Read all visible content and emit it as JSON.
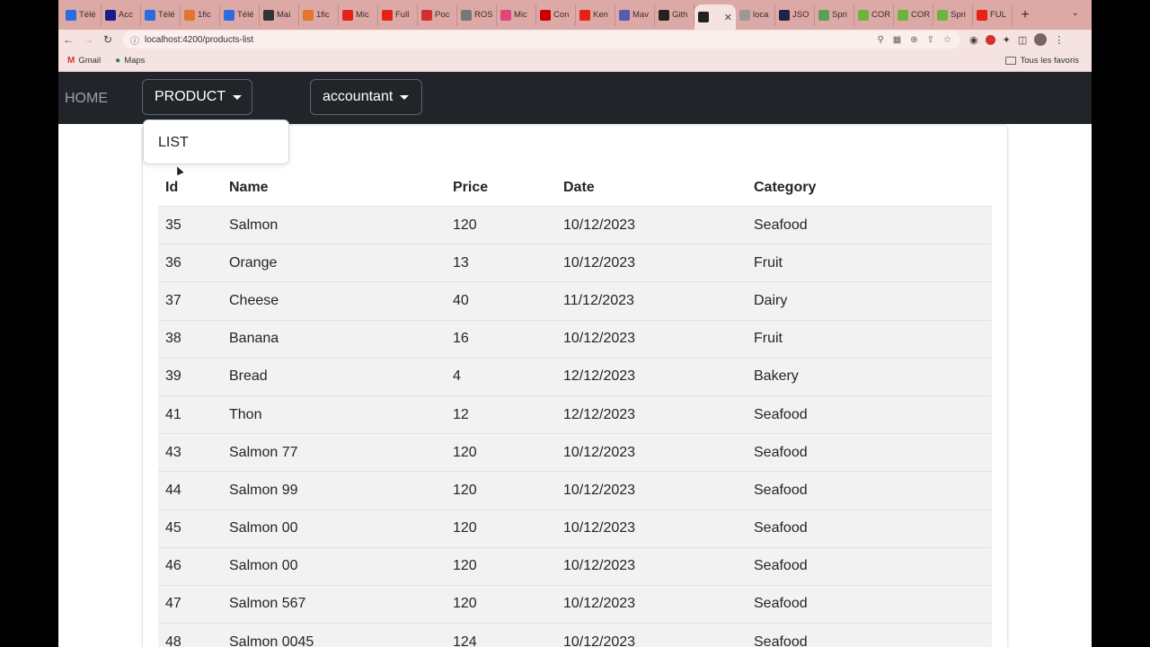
{
  "browser": {
    "tabs": [
      {
        "label": "Télé",
        "icon": "zoom-icon",
        "color": "#2d6cdf"
      },
      {
        "label": "Acc",
        "icon": "v-icon",
        "color": "#1a1a8a"
      },
      {
        "label": "Télé",
        "icon": "zoom-icon",
        "color": "#2d6cdf"
      },
      {
        "label": "1fic",
        "icon": "fire-icon",
        "color": "#e0772a"
      },
      {
        "label": "Télé",
        "icon": "zoom-icon",
        "color": "#2d6cdf"
      },
      {
        "label": "Mai",
        "icon": "mail-icon",
        "color": "#333333"
      },
      {
        "label": "1fic",
        "icon": "fire-icon",
        "color": "#e0772a"
      },
      {
        "label": "Mic",
        "icon": "youtube-icon",
        "color": "#e62117"
      },
      {
        "label": "Full",
        "icon": "youtube-icon",
        "color": "#e62117"
      },
      {
        "label": "Poc",
        "icon": "check-icon",
        "color": "#d0312d"
      },
      {
        "label": "ROS",
        "icon": "search-icon",
        "color": "#777777"
      },
      {
        "label": "Mic",
        "icon": "record-icon",
        "color": "#e0457b"
      },
      {
        "label": "Con",
        "icon": "redhat-icon",
        "color": "#cc0000"
      },
      {
        "label": "Ken",
        "icon": "youtube-icon",
        "color": "#e62117"
      },
      {
        "label": "Mav",
        "icon": "maven-icon",
        "color": "#5a5ab0"
      },
      {
        "label": "Gith",
        "icon": "github-icon",
        "color": "#222222"
      },
      {
        "label": "",
        "icon": "angular-icon",
        "color": "#222222",
        "active": true
      },
      {
        "label": "loca",
        "icon": "chart-icon",
        "color": "#999999"
      },
      {
        "label": "JSO",
        "icon": "json-icon",
        "color": "#222244"
      },
      {
        "label": "Spri",
        "icon": "diamond-icon",
        "color": "#5aa05a"
      },
      {
        "label": "COR",
        "icon": "spring-icon",
        "color": "#6db33f"
      },
      {
        "label": "COR",
        "icon": "spring-icon",
        "color": "#6db33f"
      },
      {
        "label": "Spri",
        "icon": "spring-icon",
        "color": "#6db33f"
      },
      {
        "label": "FUL",
        "icon": "youtube-icon",
        "color": "#e62117"
      }
    ],
    "url": "localhost:4200/products-list",
    "bookmarks": [
      {
        "label": "Gmail",
        "icon": "gmail-icon"
      },
      {
        "label": "Maps",
        "icon": "maps-icon"
      }
    ],
    "all_bookmarks": "Tous les favoris"
  },
  "navbar": {
    "home": "HOME",
    "product": "PRODUCT",
    "accountant": "accountant"
  },
  "dropdown": {
    "items": [
      "LIST"
    ]
  },
  "table": {
    "headers": [
      "Id",
      "Name",
      "Price",
      "Date",
      "Category"
    ],
    "rows": [
      [
        "35",
        "Salmon",
        "120",
        "10/12/2023",
        "Seafood"
      ],
      [
        "36",
        "Orange",
        "13",
        "10/12/2023",
        "Fruit"
      ],
      [
        "37",
        "Cheese",
        "40",
        "11/12/2023",
        "Dairy"
      ],
      [
        "38",
        "Banana",
        "16",
        "10/12/2023",
        "Fruit"
      ],
      [
        "39",
        "Bread",
        "4",
        "12/12/2023",
        "Bakery"
      ],
      [
        "41",
        "Thon",
        "12",
        "12/12/2023",
        "Seafood"
      ],
      [
        "43",
        "Salmon 77",
        "120",
        "10/12/2023",
        "Seafood"
      ],
      [
        "44",
        "Salmon 99",
        "120",
        "10/12/2023",
        "Seafood"
      ],
      [
        "45",
        "Salmon 00",
        "120",
        "10/12/2023",
        "Seafood"
      ],
      [
        "46",
        "Salmon 00",
        "120",
        "10/12/2023",
        "Seafood"
      ],
      [
        "47",
        "Salmon 567",
        "120",
        "10/12/2023",
        "Seafood"
      ],
      [
        "48",
        "Salmon 0045",
        "124",
        "10/12/2023",
        "Seafood"
      ]
    ]
  }
}
